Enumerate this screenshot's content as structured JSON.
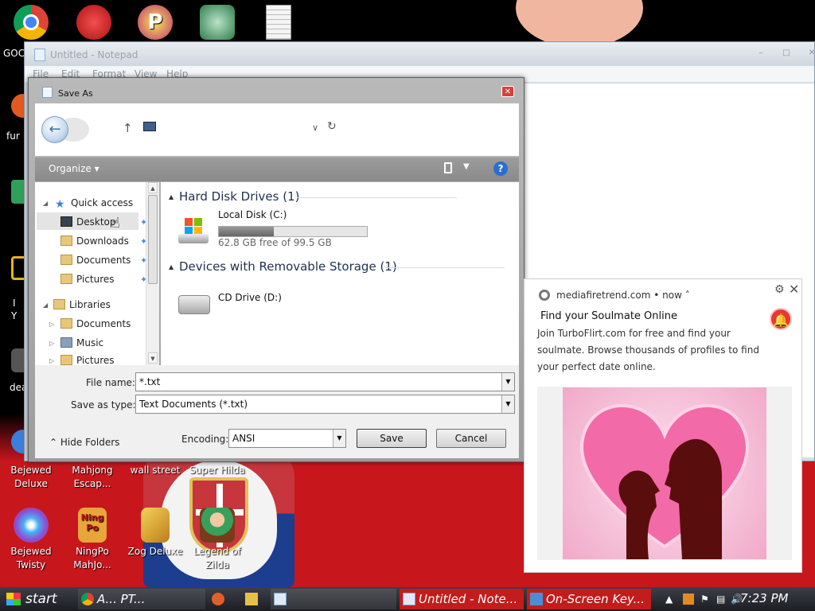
{
  "desktop": {
    "icons_top": [
      {
        "name": "chrome-icon",
        "color": "#2a8fe0"
      },
      {
        "name": "red-creature-icon",
        "color": "#d62020"
      },
      {
        "name": "p-game-icon",
        "color": "#c03070"
      },
      {
        "name": "santa-globe-icon",
        "color": "#2e7b4a"
      },
      {
        "name": "text-file-icon",
        "color": "#f4f4f4"
      }
    ],
    "left_edge_labels": [
      "GOC",
      "fur",
      "I",
      "Y",
      "dea"
    ],
    "icons_bottom_row1": [
      {
        "label1": "Bejewed",
        "label2": "Deluxe"
      },
      {
        "label1": "Mahjong",
        "label2": "Escap..."
      },
      {
        "label1": "wall street",
        "label2": ""
      },
      {
        "label1": "Super Hilda",
        "label2": ""
      }
    ],
    "icons_bottom_row2": [
      {
        "label1": "Bejewed",
        "label2": "Twisty",
        "color": "#8a4fd8"
      },
      {
        "label1": "NingPo",
        "label2": "MahJo...",
        "color": "#e7a53a",
        "badge": "Ning Po"
      },
      {
        "label1": "Zog Deluxe",
        "label2": "",
        "color": "#e0b230"
      },
      {
        "label1": "Legend of",
        "label2": "Zilda",
        "color": "#38a05a"
      }
    ]
  },
  "notepad": {
    "title": "Untitled - Notepad",
    "menu": [
      "File",
      "Edit",
      "Format",
      "View",
      "Help"
    ],
    "win_buttons": [
      "–",
      "□",
      "✕"
    ]
  },
  "saveas": {
    "title": "Save As",
    "close": "✕",
    "toolbar": {
      "organize": "Organize ▾",
      "help": "?"
    },
    "nav_tree": {
      "quick_access": "Quick access",
      "items": [
        "Desktop",
        "Downloads",
        "Documents",
        "Pictures"
      ],
      "libraries": "Libraries",
      "lib_items": [
        "Documents",
        "Music",
        "Pictures"
      ]
    },
    "groups": [
      {
        "header": "Hard Disk Drives (1)"
      },
      {
        "header": "Devices with Removable Storage (1)"
      }
    ],
    "drives": {
      "local": {
        "label": "Local Disk (C:)",
        "free_text": "62.8 GB free of 99.5 GB",
        "used_fraction": 0.37
      },
      "cd": {
        "label": "CD Drive (D:)"
      }
    },
    "bottom": {
      "file_name_label": "File name:",
      "file_name_value": "*.txt",
      "type_label": "Save as type:",
      "type_value": "Text Documents (*.txt)",
      "encoding_label": "Encoding:",
      "encoding_value": "ANSI",
      "save": "Save",
      "cancel": "Cancel",
      "hide_folders": "Hide Folders"
    }
  },
  "notification": {
    "site": "mediafiretrend.com",
    "time": "• now ˄",
    "title": "Find your Soulmate Online",
    "body": "Join TurboFlirt.com for free and find your soulmate. Browse thousands of profiles to find your perfect date online.",
    "gear": "⚙",
    "close": "✕"
  },
  "taskbar": {
    "start": "start",
    "items": [
      {
        "label": "A... PT...",
        "color": "#1e6ad1"
      },
      {
        "label": "",
        "color": "#e0602a"
      },
      {
        "label": "",
        "color": "#e7c04a"
      },
      {
        "label": "Untitled - Note...",
        "color": "#3a7fd9"
      },
      {
        "label": "Untitled - Note...",
        "color": "#cc1a1a"
      },
      {
        "label": "On-Screen Key...",
        "color": "#cc1a1a"
      }
    ],
    "clock": "7:23 PM"
  },
  "colors": {
    "accent_red": "#c8161d",
    "taskbar_dark": "#1c1d22",
    "help_blue": "#2a6ed5"
  }
}
